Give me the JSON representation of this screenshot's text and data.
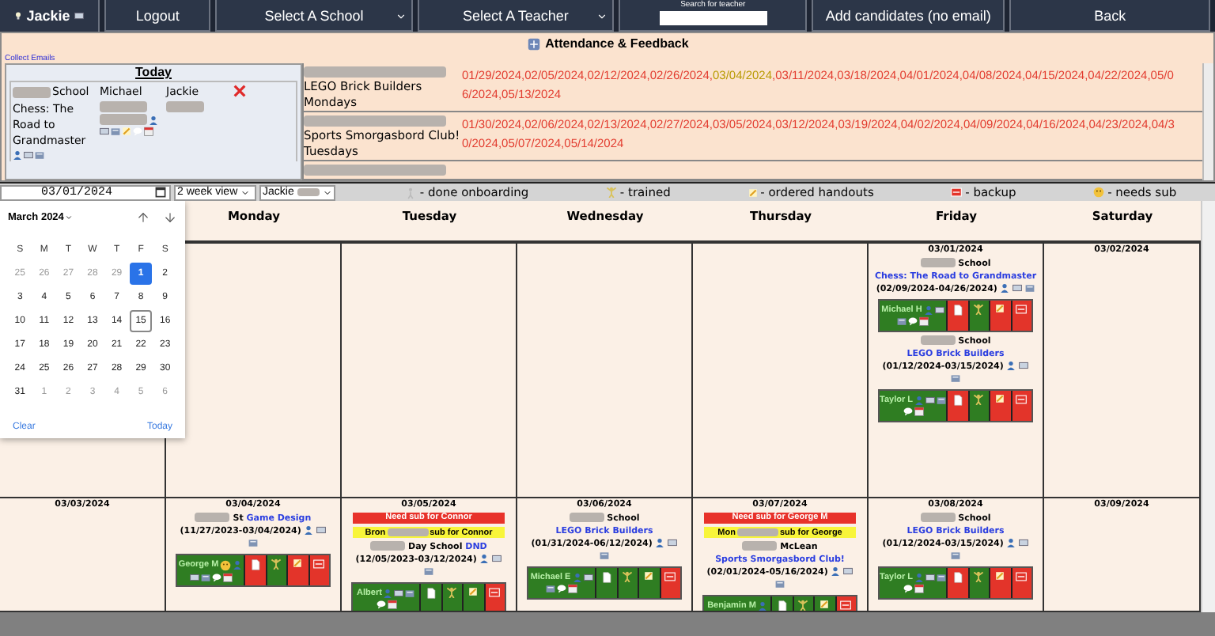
{
  "header": {
    "user": "Jackie",
    "items": [
      {
        "kind": "button",
        "label": "Logout"
      },
      {
        "kind": "select",
        "label": "Select A School"
      },
      {
        "kind": "select",
        "label": "Select A Teacher"
      },
      {
        "kind": "search",
        "label": "Search for teacher"
      },
      {
        "kind": "button",
        "label": "Add candidates (no email)"
      },
      {
        "kind": "button",
        "label": "Back"
      }
    ]
  },
  "attendance": {
    "title": "Attendance & Feedback",
    "link": "Collect Emails",
    "today": {
      "heading": "Today",
      "rows": [
        {
          "school": "School",
          "class": "Chess: The Road to Grandmaster",
          "teacher": "Michael",
          "staff": "Jackie"
        }
      ]
    },
    "classes": [
      {
        "name": "LEGO Brick Builders Mondays",
        "dates": [
          {
            "text": "01/29/2024,02/05/2024,02/12/2024,02/26/2024,",
            "current": false
          },
          {
            "text": "03/04/2024",
            "current": true
          },
          {
            "text": ",03/11/2024,03/18/2024,04/01/2024,04/08/2024,04/15/2024,04/22/2024,05/06/2024,05/13/2024",
            "current": false
          }
        ]
      },
      {
        "name": "Sports Smorgasbord Club! Tuesdays",
        "dates": [
          {
            "text": "01/30/2024,02/06/2024,02/13/2024,02/27/2024,03/05/2024,03/12/2024,03/19/2024,04/02/2024,04/09/2024,04/16/2024,04/23/2024,04/30/2024,05/07/2024,05/14/2024",
            "current": false
          }
        ]
      }
    ]
  },
  "toolbar": {
    "date": "03/01/2024",
    "view": "2 week view",
    "person": "Jackie",
    "legend": [
      {
        "kind": "onboarding",
        "label": "- done onboarding"
      },
      {
        "kind": "trained",
        "label": "- trained"
      },
      {
        "kind": "handouts",
        "label": "- ordered handouts"
      },
      {
        "kind": "backup",
        "label": "- backup"
      },
      {
        "kind": "needs_sub",
        "label": "- needs sub"
      }
    ]
  },
  "datepicker": {
    "month": "March 2024",
    "weekdays": [
      "S",
      "M",
      "T",
      "W",
      "T",
      "F",
      "S"
    ],
    "clear": "Clear",
    "today": "Today",
    "days": [
      {
        "day": "25",
        "outside": true,
        "selected": false,
        "today": false
      },
      {
        "day": "26",
        "outside": true,
        "selected": false,
        "today": false
      },
      {
        "day": "27",
        "outside": true,
        "selected": false,
        "today": false
      },
      {
        "day": "28",
        "outside": true,
        "selected": false,
        "today": false
      },
      {
        "day": "29",
        "outside": true,
        "selected": false,
        "today": false
      },
      {
        "day": "1",
        "outside": false,
        "selected": true,
        "today": false
      },
      {
        "day": "2",
        "outside": false,
        "selected": false,
        "today": false
      },
      {
        "day": "3",
        "outside": false,
        "selected": false,
        "today": false
      },
      {
        "day": "4",
        "outside": false,
        "selected": false,
        "today": false
      },
      {
        "day": "5",
        "outside": false,
        "selected": false,
        "today": false
      },
      {
        "day": "6",
        "outside": false,
        "selected": false,
        "today": false
      },
      {
        "day": "7",
        "outside": false,
        "selected": false,
        "today": false
      },
      {
        "day": "8",
        "outside": false,
        "selected": false,
        "today": false
      },
      {
        "day": "9",
        "outside": false,
        "selected": false,
        "today": false
      },
      {
        "day": "10",
        "outside": false,
        "selected": false,
        "today": false
      },
      {
        "day": "11",
        "outside": false,
        "selected": false,
        "today": false
      },
      {
        "day": "12",
        "outside": false,
        "selected": false,
        "today": false
      },
      {
        "day": "13",
        "outside": false,
        "selected": false,
        "today": false
      },
      {
        "day": "14",
        "outside": false,
        "selected": false,
        "today": false
      },
      {
        "day": "15",
        "outside": false,
        "selected": false,
        "today": true
      },
      {
        "day": "16",
        "outside": false,
        "selected": false,
        "today": false
      },
      {
        "day": "17",
        "outside": false,
        "selected": false,
        "today": false
      },
      {
        "day": "18",
        "outside": false,
        "selected": false,
        "today": false
      },
      {
        "day": "19",
        "outside": false,
        "selected": false,
        "today": false
      },
      {
        "day": "20",
        "outside": false,
        "selected": false,
        "today": false
      },
      {
        "day": "21",
        "outside": false,
        "selected": false,
        "today": false
      },
      {
        "day": "22",
        "outside": false,
        "selected": false,
        "today": false
      },
      {
        "day": "23",
        "outside": false,
        "selected": false,
        "today": false
      },
      {
        "day": "24",
        "outside": false,
        "selected": false,
        "today": false
      },
      {
        "day": "25",
        "outside": false,
        "selected": false,
        "today": false
      },
      {
        "day": "26",
        "outside": false,
        "selected": false,
        "today": false
      },
      {
        "day": "27",
        "outside": false,
        "selected": false,
        "today": false
      },
      {
        "day": "28",
        "outside": false,
        "selected": false,
        "today": false
      },
      {
        "day": "29",
        "outside": false,
        "selected": false,
        "today": false
      },
      {
        "day": "30",
        "outside": false,
        "selected": false,
        "today": false
      },
      {
        "day": "31",
        "outside": false,
        "selected": false,
        "today": false
      },
      {
        "day": "1",
        "outside": true,
        "selected": false,
        "today": false
      },
      {
        "day": "2",
        "outside": true,
        "selected": false,
        "today": false
      },
      {
        "day": "3",
        "outside": true,
        "selected": false,
        "today": false
      },
      {
        "day": "4",
        "outside": true,
        "selected": false,
        "today": false
      },
      {
        "day": "5",
        "outside": true,
        "selected": false,
        "today": false
      },
      {
        "day": "6",
        "outside": true,
        "selected": false,
        "today": false
      }
    ]
  },
  "calendar": {
    "days": [
      "Monday",
      "Tuesday",
      "Wednesday",
      "Thursday",
      "Friday",
      "Saturday"
    ],
    "weeks": [
      {
        "cells": [
          {},
          {},
          {},
          {},
          {},
          {
            "date": "03/01/2024",
            "events": [
              {
                "prefix": "School",
                "title": "Chess: The Road to Grandmaster",
                "range": "(02/09/2024-04/26/2024)",
                "teacher": "Michael H",
                "needs_sub": false,
                "checks": [
                  false,
                  true,
                  false,
                  false
                ]
              },
              {
                "prefix": "School",
                "title": "LEGO Brick Builders",
                "range": "(01/12/2024-03/15/2024)",
                "teacher": "Taylor L",
                "needs_sub": false,
                "checks": [
                  false,
                  true,
                  false,
                  false
                ]
              }
            ]
          },
          {
            "date": "03/02/2024"
          }
        ]
      },
      {
        "cells": [
          {
            "date": "03/03/2024"
          },
          {
            "date": "03/04/2024",
            "events": [
              {
                "prefix": "St",
                "title": "Game Design",
                "range": "(11/27/2023-03/04/2024)",
                "teacher": "George M",
                "needs_sub": true,
                "checks": [
                  false,
                  true,
                  false,
                  false
                ]
              }
            ]
          },
          {
            "date": "03/05/2024",
            "events": [
              {
                "alert": {
                  "need": "Need sub for Connor",
                  "sub": "Bron",
                  "rest": "sub for Connor"
                },
                "prefix": "Day School",
                "title": "DND",
                "range": "(12/05/2023-03/12/2024)",
                "teacher": "Albert",
                "needs_sub": false,
                "checks": [
                  true,
                  true,
                  true,
                  false
                ]
              }
            ]
          },
          {
            "date": "03/06/2024",
            "events": [
              {
                "prefix": "School",
                "title": "LEGO Brick Builders",
                "range": "(01/31/2024-06/12/2024)",
                "teacher": "Michael E",
                "needs_sub": false,
                "checks": [
                  true,
                  true,
                  true,
                  false
                ]
              }
            ]
          },
          {
            "date": "03/07/2024",
            "events": [
              {
                "alert": {
                  "need": "Need sub for George M",
                  "sub": "Mon",
                  "rest": "sub for George"
                },
                "prefix": "McLean",
                "title": "Sports Smorgasbord Club!",
                "range": "(02/01/2024-05/16/2024)",
                "teacher": "Benjamin M",
                "needs_sub": false,
                "checks": [
                  true,
                  true,
                  true,
                  false
                ]
              }
            ]
          },
          {
            "date": "03/08/2024",
            "events": [
              {
                "prefix": "School",
                "title": "LEGO Brick Builders",
                "range": "(01/12/2024-03/15/2024)",
                "teacher": "Taylor L",
                "needs_sub": false,
                "checks": [
                  false,
                  true,
                  false,
                  false
                ]
              }
            ]
          },
          {
            "date": "03/09/2024"
          }
        ]
      }
    ]
  }
}
